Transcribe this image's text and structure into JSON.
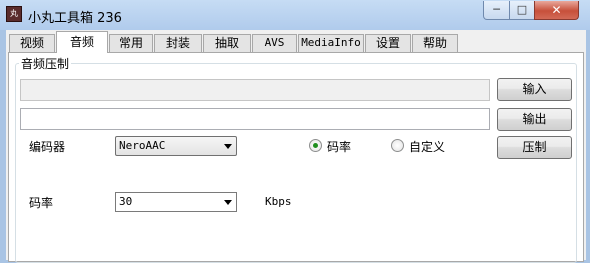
{
  "window": {
    "title": "小丸工具箱 236",
    "app_icon_text": "丸",
    "controls": {
      "minimize": "─",
      "maximize": "□",
      "close": "✕"
    }
  },
  "tabs": [
    {
      "label": "视频",
      "active": false
    },
    {
      "label": "音频",
      "active": true
    },
    {
      "label": "常用",
      "active": false
    },
    {
      "label": "封装",
      "active": false
    },
    {
      "label": "抽取",
      "active": false
    },
    {
      "label": "AVS",
      "active": false
    },
    {
      "label": "MediaInfo",
      "active": false
    },
    {
      "label": "设置",
      "active": false
    },
    {
      "label": "帮助",
      "active": false
    }
  ],
  "audio": {
    "group_title": "音频压制",
    "input_path": "",
    "output_path": "",
    "input_button": "输入",
    "output_button": "输出",
    "encode_button": "压制",
    "encoder_label": "编码器",
    "encoder_value": "NeroAAC",
    "bitrate_label": "码率",
    "bitrate_value": "30",
    "bitrate_unit": "Kbps",
    "mode_options": [
      {
        "label": "码率",
        "selected": true
      },
      {
        "label": "自定义",
        "selected": false
      }
    ]
  },
  "colors": {
    "highlight": "#c9252b",
    "radio_selected": "#1e8e1e"
  }
}
